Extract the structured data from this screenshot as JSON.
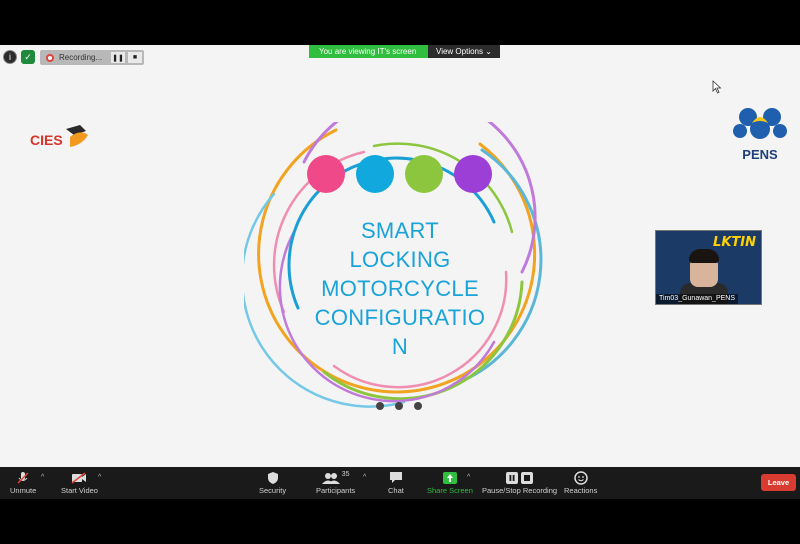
{
  "meeting": {
    "recording_label": "Recording...",
    "viewing_banner": "You are viewing IT's screen",
    "view_options_label": "View Options"
  },
  "slide": {
    "title_lines": [
      "SMART",
      "LOCKING",
      "MOTORCYCLE",
      "CONFIGURATIO",
      "N"
    ],
    "left_logo_text": "CIES",
    "right_logo_text": "PENS",
    "dot_colors": [
      "#f0498a",
      "#11a8de",
      "#8cc63f",
      "#9b3fd6"
    ]
  },
  "participant_video": {
    "name": "Tim03_Gunawan_PENS",
    "banner_text": "LKTIN"
  },
  "toolbar": {
    "unmute_label": "Unmute",
    "start_video_label": "Start Video",
    "security_label": "Security",
    "participants_label": "Participants",
    "participants_count": "35",
    "chat_label": "Chat",
    "share_screen_label": "Share Screen",
    "pause_stop_label": "Pause/Stop Recording",
    "reactions_label": "Reactions",
    "leave_label": "Leave"
  }
}
